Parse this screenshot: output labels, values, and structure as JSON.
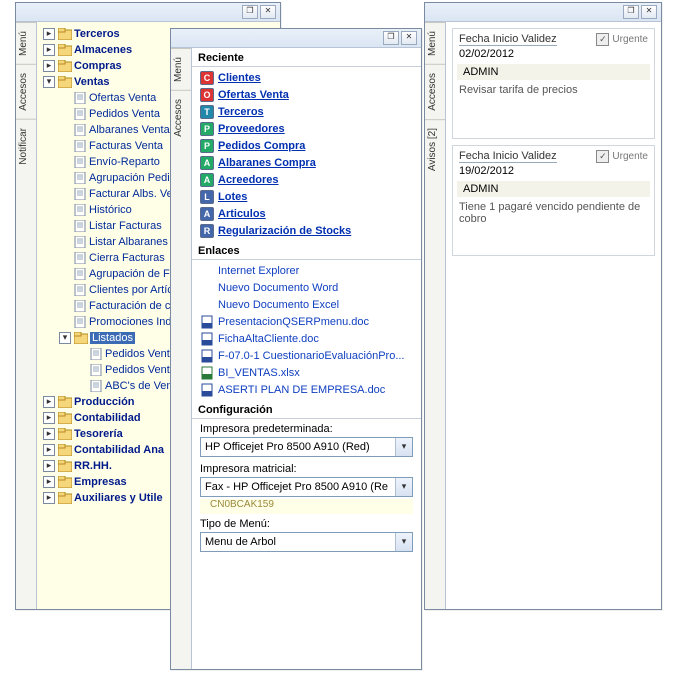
{
  "left": {
    "tabs": [
      "Menú",
      "Accesos",
      "Notificar"
    ],
    "tree": [
      {
        "level": 0,
        "toggle": "+",
        "kind": "folder",
        "label": "Terceros",
        "bold": true
      },
      {
        "level": 0,
        "toggle": "+",
        "kind": "folder",
        "label": "Almacenes",
        "bold": true
      },
      {
        "level": 0,
        "toggle": "+",
        "kind": "folder",
        "label": "Compras",
        "bold": true
      },
      {
        "level": 0,
        "toggle": "-",
        "kind": "folder",
        "label": "Ventas",
        "bold": true
      },
      {
        "level": 1,
        "kind": "doc",
        "label": "Ofertas Venta"
      },
      {
        "level": 1,
        "kind": "doc",
        "label": "Pedidos Venta"
      },
      {
        "level": 1,
        "kind": "doc",
        "label": "Albaranes Venta"
      },
      {
        "level": 1,
        "kind": "doc",
        "label": "Facturas Venta"
      },
      {
        "level": 1,
        "kind": "doc",
        "label": "Envío-Reparto"
      },
      {
        "level": 1,
        "kind": "doc",
        "label": "Agrupación Pedid"
      },
      {
        "level": 1,
        "kind": "doc",
        "label": "Facturar Albs. Ver"
      },
      {
        "level": 1,
        "kind": "doc",
        "label": "Histórico"
      },
      {
        "level": 1,
        "kind": "doc",
        "label": "Listar Facturas"
      },
      {
        "level": 1,
        "kind": "doc",
        "label": "Listar Albaranes"
      },
      {
        "level": 1,
        "kind": "doc",
        "label": "Cierra Facturas"
      },
      {
        "level": 1,
        "kind": "doc",
        "label": "Agrupación de Fa"
      },
      {
        "level": 1,
        "kind": "doc",
        "label": "Clientes por Artícu"
      },
      {
        "level": 1,
        "kind": "doc",
        "label": "Facturación de cu"
      },
      {
        "level": 1,
        "kind": "doc",
        "label": "Promociones Indir"
      },
      {
        "level": 1,
        "toggle": "-",
        "kind": "folder",
        "label": "Listados",
        "selected": true
      },
      {
        "level": 2,
        "kind": "doc",
        "label": "Pedidos Venta"
      },
      {
        "level": 2,
        "kind": "doc",
        "label": "Pedidos Venta"
      },
      {
        "level": 2,
        "kind": "doc",
        "label": "ABC's de Vent"
      },
      {
        "level": 0,
        "toggle": "+",
        "kind": "folder",
        "label": "Producción",
        "bold": true
      },
      {
        "level": 0,
        "toggle": "+",
        "kind": "folder",
        "label": "Contabilidad",
        "bold": true
      },
      {
        "level": 0,
        "toggle": "+",
        "kind": "folder",
        "label": "Tesorería",
        "bold": true
      },
      {
        "level": 0,
        "toggle": "+",
        "kind": "folder",
        "label": "Contabilidad Ana",
        "bold": true
      },
      {
        "level": 0,
        "toggle": "+",
        "kind": "folder",
        "label": "RR.HH.",
        "bold": true
      },
      {
        "level": 0,
        "toggle": "+",
        "kind": "folder",
        "label": "Empresas",
        "bold": true
      },
      {
        "level": 0,
        "toggle": "+",
        "kind": "folder",
        "label": "Auxiliares y Utile",
        "bold": true
      }
    ]
  },
  "middle": {
    "tabs": [
      "Menú",
      "Accesos"
    ],
    "sections": {
      "reciente_h": "Reciente",
      "reciente": [
        {
          "icon": "C",
          "color": "#d33",
          "label": "Clientes"
        },
        {
          "icon": "O",
          "color": "#d33",
          "label": "Ofertas Venta"
        },
        {
          "icon": "T",
          "color": "#28a",
          "label": "Terceros"
        },
        {
          "icon": "P",
          "color": "#2a6",
          "label": "Proveedores"
        },
        {
          "icon": "P",
          "color": "#2a6",
          "label": "Pedidos Compra"
        },
        {
          "icon": "A",
          "color": "#2a6",
          "label": "Albaranes Compra"
        },
        {
          "icon": "A",
          "color": "#2a6",
          "label": "Acreedores"
        },
        {
          "icon": "L",
          "color": "#46a",
          "label": "Lotes"
        },
        {
          "icon": "A",
          "color": "#46a",
          "label": "Articulos"
        },
        {
          "icon": "R",
          "color": "#46a",
          "label": "Regularización de Stocks"
        }
      ],
      "enlaces_h": "Enlaces",
      "enlaces": [
        {
          "icon": "",
          "label": "Internet Explorer"
        },
        {
          "icon": "",
          "label": "Nuevo Documento Word"
        },
        {
          "icon": "",
          "label": "Nuevo Documento Excel"
        },
        {
          "icon": "doc",
          "label": "PresentacionQSERPmenu.doc"
        },
        {
          "icon": "doc",
          "label": "FichaAltaCliente.doc"
        },
        {
          "icon": "doc",
          "label": "F-07.0-1 CuestionarioEvaluaciónPro..."
        },
        {
          "icon": "xls",
          "label": "BI_VENTAS.xlsx"
        },
        {
          "icon": "doc",
          "label": "ASERTI PLAN DE EMPRESA.doc"
        }
      ],
      "config_h": "Configuración",
      "config": {
        "printer_label": "Impresora predeterminada:",
        "printer_value": "HP Officejet Pro 8500 A910 (Red)",
        "matrix_label": "Impresora matricial:",
        "matrix_value": "Fax - HP Officejet Pro 8500 A910 (Re",
        "serial": "CN0BCAK159",
        "menu_label": "Tipo de Menú:",
        "menu_value": "Menu de Arbol"
      }
    }
  },
  "right": {
    "tabs": [
      "Menú",
      "Accesos",
      "Avisos [2]"
    ],
    "notices": [
      {
        "title": "Fecha Inicio Validez",
        "date": "02/02/2012",
        "urgent_label": "Urgente",
        "user": "ADMIN",
        "body": "Revisar tarifa de precios"
      },
      {
        "title": "Fecha Inicio Validez",
        "date": "19/02/2012",
        "urgent_label": "Urgente",
        "user": "ADMIN",
        "body": "Tiene 1 pagaré vencido pendiente de cobro"
      }
    ]
  }
}
